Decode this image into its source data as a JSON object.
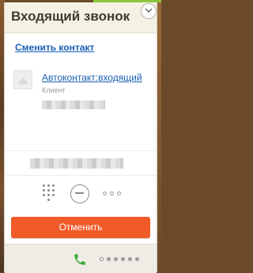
{
  "header": {
    "title": "Входящий звонок"
  },
  "change_contact": {
    "label": "Сменить контакт"
  },
  "contact": {
    "name": "Автоконтакт:входящий",
    "role": "Клиент"
  },
  "actions": {
    "cancel_label": "Отменить"
  },
  "icons": {
    "collapse": "chevron-down-icon",
    "avatar": "contact-avatar-icon",
    "dialpad": "dialpad-icon",
    "hold": "hold-icon",
    "more": "more-icon",
    "phone": "phone-icon"
  },
  "colors": {
    "accent": "#f15a29",
    "link": "#1a5fb4",
    "header_bg": "#f5f1e4",
    "phone_green": "#3aaa35"
  }
}
